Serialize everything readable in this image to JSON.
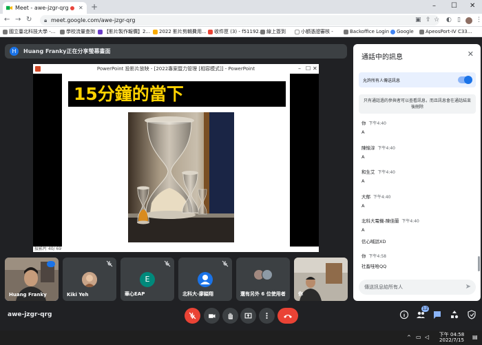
{
  "browser": {
    "tab_title": "Meet - awe-jzgr-qrg",
    "url": "meet.google.com/awe-jzgr-qrg",
    "bookmarks": [
      "國立臺北科技大學 -...",
      "學校流量查詢",
      "【影片製作報價】2...",
      "2022 影片剪輯費用...",
      "收件匣 (3) - f51192...",
      "線上簽到",
      "小額憑證審核 -",
      "Backoffice Login",
      "Google",
      "ApeosPort-IV C33..."
    ]
  },
  "presenter": {
    "initial": "H",
    "text": "Huang Franky正在分享螢幕畫面"
  },
  "shared_screen": {
    "window_title": "PowerPoint 投影片放映 - [2022專案暨力管理 [相容模式]] - PowerPoint",
    "slide_title": "15分鐘的當下",
    "status": "投影片 40/ 69"
  },
  "participants": [
    {
      "name": "Huang Franky",
      "type": "video"
    },
    {
      "name": "Kiki Yeh",
      "type": "photo"
    },
    {
      "name": "華心EAP",
      "type": "initial",
      "initial": "E",
      "color": "#00897b"
    },
    {
      "name": "北科大-廖鎰翔",
      "type": "person",
      "color": "#1a73e8"
    },
    {
      "name": "還有另外 6 位使用者",
      "type": "group"
    },
    {
      "name": "你",
      "type": "video"
    }
  ],
  "controls": {
    "meeting_code": "awe-jzgr-qrg",
    "people_count": "12"
  },
  "chat": {
    "title": "通話中的訊息",
    "allow_label": "允許所有人傳送訊息",
    "notice": "只有通話過的參與者可以查看訊息，而且訊息會在通話結束後刪除",
    "messages": [
      {
        "who": "你",
        "time": "下午4:40",
        "body": "A"
      },
      {
        "who": "陳愉淳",
        "time": "下午4:40",
        "body": "A"
      },
      {
        "who": "和生艾",
        "time": "下午4:40",
        "body": "A"
      },
      {
        "who": "大郁",
        "time": "下午4:40",
        "body": "A"
      },
      {
        "who": "北科大電機-陳佳蘭",
        "time": "下午4:40",
        "body": "A"
      },
      {
        "who": "",
        "time": "",
        "body": "信心喊話XD"
      },
      {
        "who": "你",
        "time": "下午4:58",
        "body": "社畜哇哈QQ"
      }
    ],
    "input_placeholder": "傳送訊息給所有人"
  },
  "taskbar": {
    "time": "下午 04:58",
    "date": "2022/7/15"
  }
}
